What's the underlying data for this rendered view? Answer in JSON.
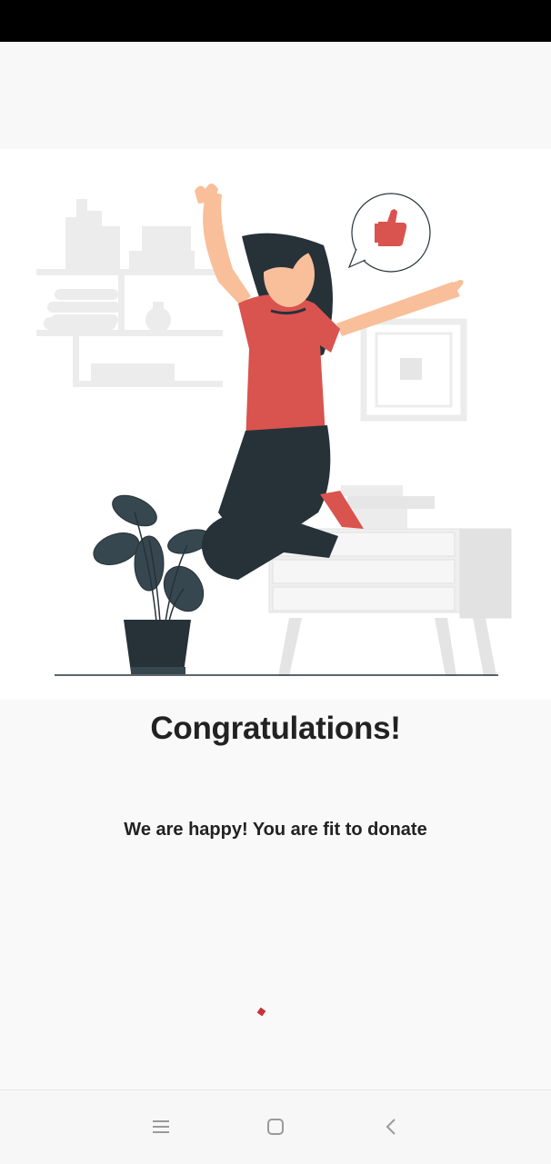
{
  "screen": {
    "title": "Congratulations!",
    "message": "We are happy! You are fit to donate"
  },
  "colors": {
    "accent": "#c8323d",
    "text": "#222222",
    "background": "#f9f9f9",
    "illustration_dark": "#263238",
    "illustration_red": "#d9534f"
  },
  "navigation": {
    "menu_icon": "menu-icon",
    "home_icon": "home-square-icon",
    "back_icon": "back-chevron-icon"
  }
}
